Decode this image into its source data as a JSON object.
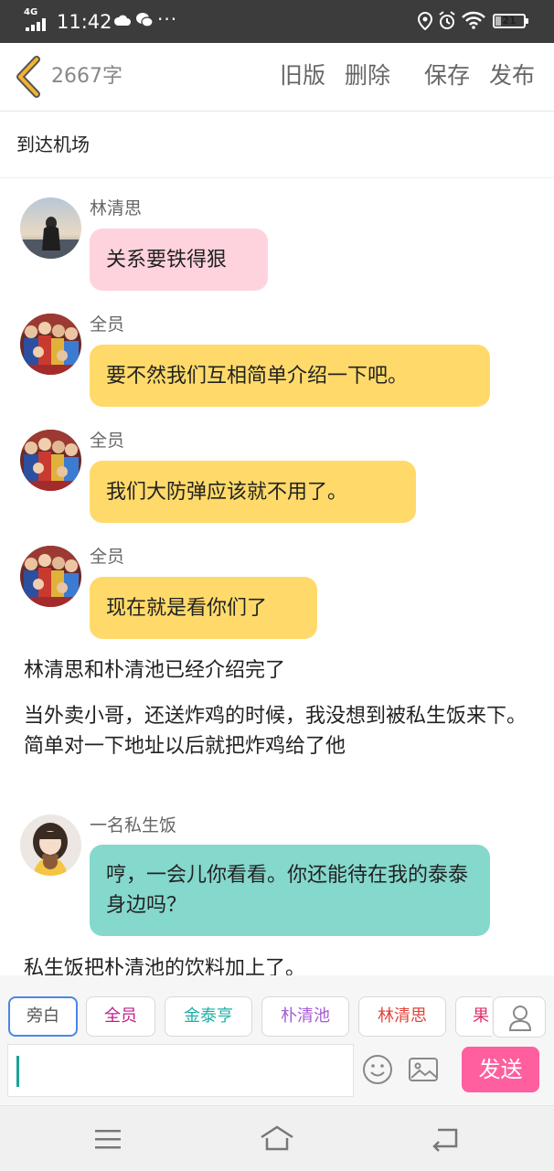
{
  "status_bar": {
    "network": "4G",
    "time": "11:42",
    "more": "···",
    "battery": "21",
    "battery_level": 0.21
  },
  "header": {
    "word_count": "2667字",
    "old_version": "旧版",
    "delete": "删除",
    "save": "保存",
    "publish": "发布"
  },
  "chapter_title": "到达机场",
  "messages": [
    {
      "speaker": "林清思",
      "text": "关系要铁得狠",
      "bubble_color": "#ffd3dd",
      "avatar": "girl-sunset-avatar"
    },
    {
      "speaker": "全员",
      "text": "要不然我们互相简单介绍一下吧。",
      "bubble_color": "#ffda6a",
      "avatar": "group-photo-avatar"
    },
    {
      "speaker": "全员",
      "text": "我们大防弹应该就不用了。",
      "bubble_color": "#ffda6a",
      "avatar": "group-photo-avatar"
    },
    {
      "speaker": "全员",
      "text": "现在就是看你们了",
      "bubble_color": "#ffda6a",
      "avatar": "group-photo-avatar"
    }
  ],
  "narration": [
    "林清思和朴清池已经介绍完了",
    "当外卖小哥，还送炸鸡的时候，我没想到被私生饭来下。简单对一下地址以后就把炸鸡给了他"
  ],
  "message_5": {
    "speaker": "一名私生饭",
    "text": "哼，一会儿你看看。你还能待在我的泰泰身边吗？",
    "bubble_color": "#85d8cc",
    "avatar": "girl-bear-avatar"
  },
  "narration_last": "私生饭把朴清池的饮料加上了。",
  "toolbar": {
    "narrator_chip": "旁白",
    "characters": [
      {
        "label": "全员",
        "color": "#c0208a"
      },
      {
        "label": "金泰亨",
        "color": "#1ab0a8"
      },
      {
        "label": "朴清池",
        "color": "#a45bd6"
      },
      {
        "label": "林清思",
        "color": "#e0443a"
      },
      {
        "label": "果",
        "color": "#e0306a"
      }
    ],
    "input_placeholder": "",
    "send": "发送"
  },
  "colors": {
    "accent_pink": "#ff5f9e",
    "teal_caret": "#1aa39a",
    "back_arrow": "#e8a826"
  }
}
